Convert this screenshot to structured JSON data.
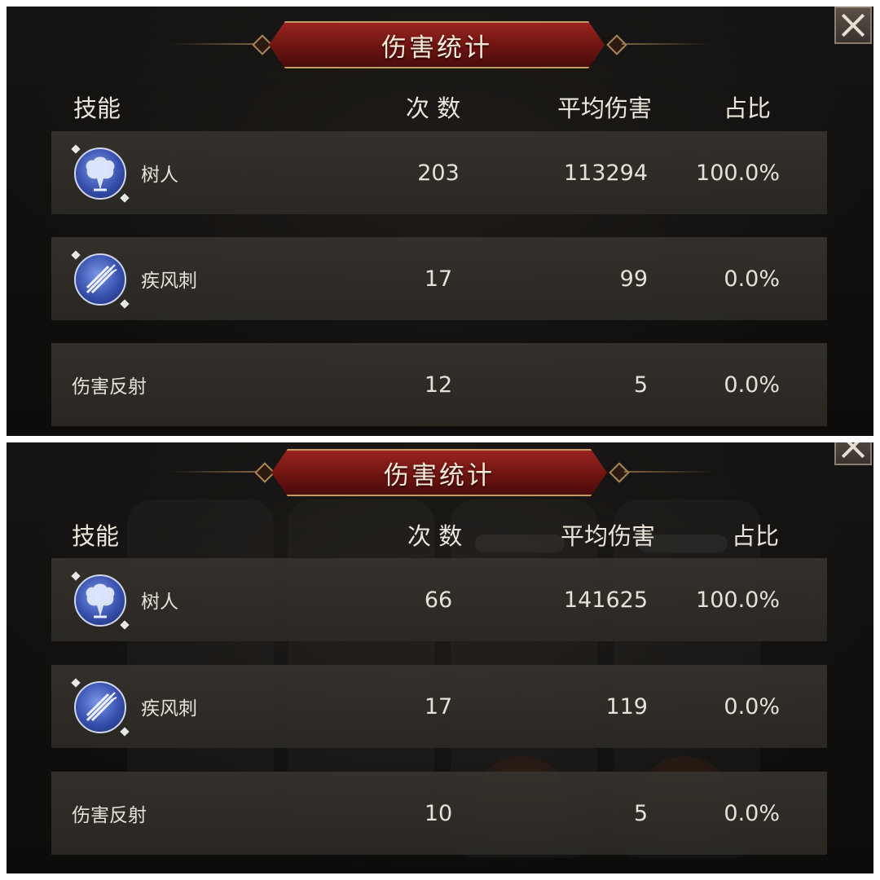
{
  "panels": [
    {
      "title": "伤害统计",
      "headers": {
        "skill": "技能",
        "count": "次 数",
        "avg": "平均伤害",
        "pct": "占比"
      },
      "rows": [
        {
          "name": "树人",
          "icon": "tree-spirit-icon",
          "count": "203",
          "avg": "113294",
          "pct": "100.0%"
        },
        {
          "name": "疾风刺",
          "icon": "wind-thrust-icon",
          "count": "17",
          "avg": "99",
          "pct": "0.0%"
        },
        {
          "name": "伤害反射",
          "icon": "",
          "count": "12",
          "avg": "5",
          "pct": "0.0%"
        }
      ]
    },
    {
      "title": "伤害统计",
      "headers": {
        "skill": "技能",
        "count": "次 数",
        "avg": "平均伤害",
        "pct": "占比"
      },
      "rows": [
        {
          "name": "树人",
          "icon": "tree-spirit-icon",
          "count": "66",
          "avg": "141625",
          "pct": "100.0%"
        },
        {
          "name": "疾风刺",
          "icon": "wind-thrust-icon",
          "count": "17",
          "avg": "119",
          "pct": "0.0%"
        },
        {
          "name": "伤害反射",
          "icon": "",
          "count": "10",
          "avg": "5",
          "pct": "0.0%"
        }
      ]
    }
  ],
  "colors": {
    "banner": "#7a1714",
    "banner_border": "#c29a63",
    "row_bg": "#33302c",
    "text": "#e6e1d8"
  }
}
